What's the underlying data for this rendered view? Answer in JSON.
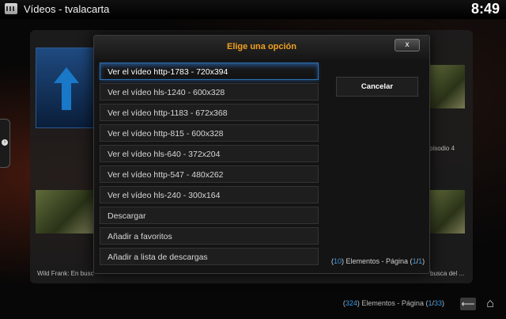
{
  "header": {
    "breadcrumb": "Vídeos  - tvalacarta",
    "clock": "8:49"
  },
  "background": {
    "label_left": "Wild Frank: En busc",
    "label_right": "busca del ...",
    "label_episode": "pisodio 4",
    "item_count": "324",
    "count_prefix": "(",
    "count_mid": ") Elementos - Página (",
    "page_current": "1",
    "page_sep": "/",
    "page_total": "33",
    "count_suffix": ")"
  },
  "dialog": {
    "title": "Elige una opción",
    "close_label": "x",
    "cancel_label": "Cancelar",
    "options": [
      "Ver el vídeo http-1783 - 720x394",
      "Ver el vídeo hls-1240 - 600x328",
      "Ver el vídeo http-1183 - 672x368",
      "Ver el vídeo http-815 - 600x328",
      "Ver el vídeo hls-640 - 372x204",
      "Ver el vídeo http-547 - 480x262",
      "Ver el vídeo hls-240 - 300x164",
      "Descargar",
      "Añadir a favoritos",
      "Añadir a lista de descargas"
    ],
    "focused_index": 0,
    "count": {
      "open": "(",
      "items": "10",
      "mid": ") Elementos - Página (",
      "page": "1",
      "sep": "/",
      "total": "1",
      "close": ")"
    }
  },
  "colors": {
    "title": "#f0a020",
    "accent": "#3a9ae8",
    "focus_border": "#2f6fb0"
  }
}
